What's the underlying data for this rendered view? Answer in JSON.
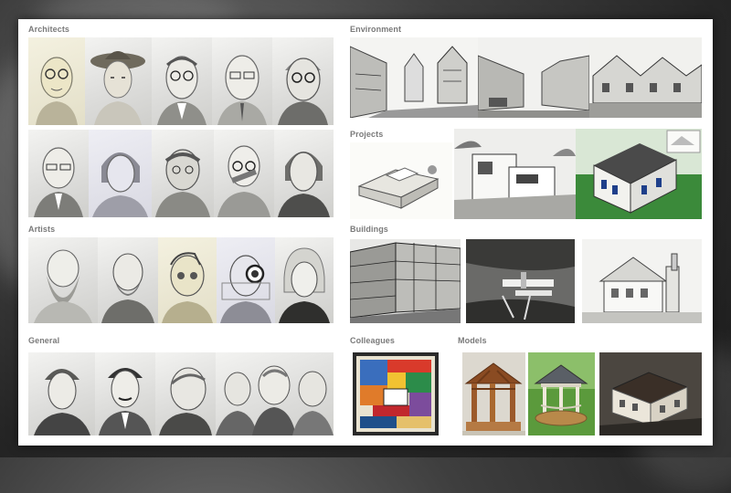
{
  "sections": {
    "architects": "Architects",
    "environment": "Environment",
    "projects": "Projects",
    "artists": "Artists",
    "buildings": "Buildings",
    "general": "General",
    "colleagues": "Colleagues",
    "models": "Models"
  },
  "palette": {
    "background": "#2a2a2a",
    "sheet": "#ffffff",
    "label": "#7a7a7a",
    "pencil": "#555555",
    "warm_paper": "#f4f1e0",
    "model_green": "#3b8a3a",
    "model_wood": "#9c5a2b"
  }
}
